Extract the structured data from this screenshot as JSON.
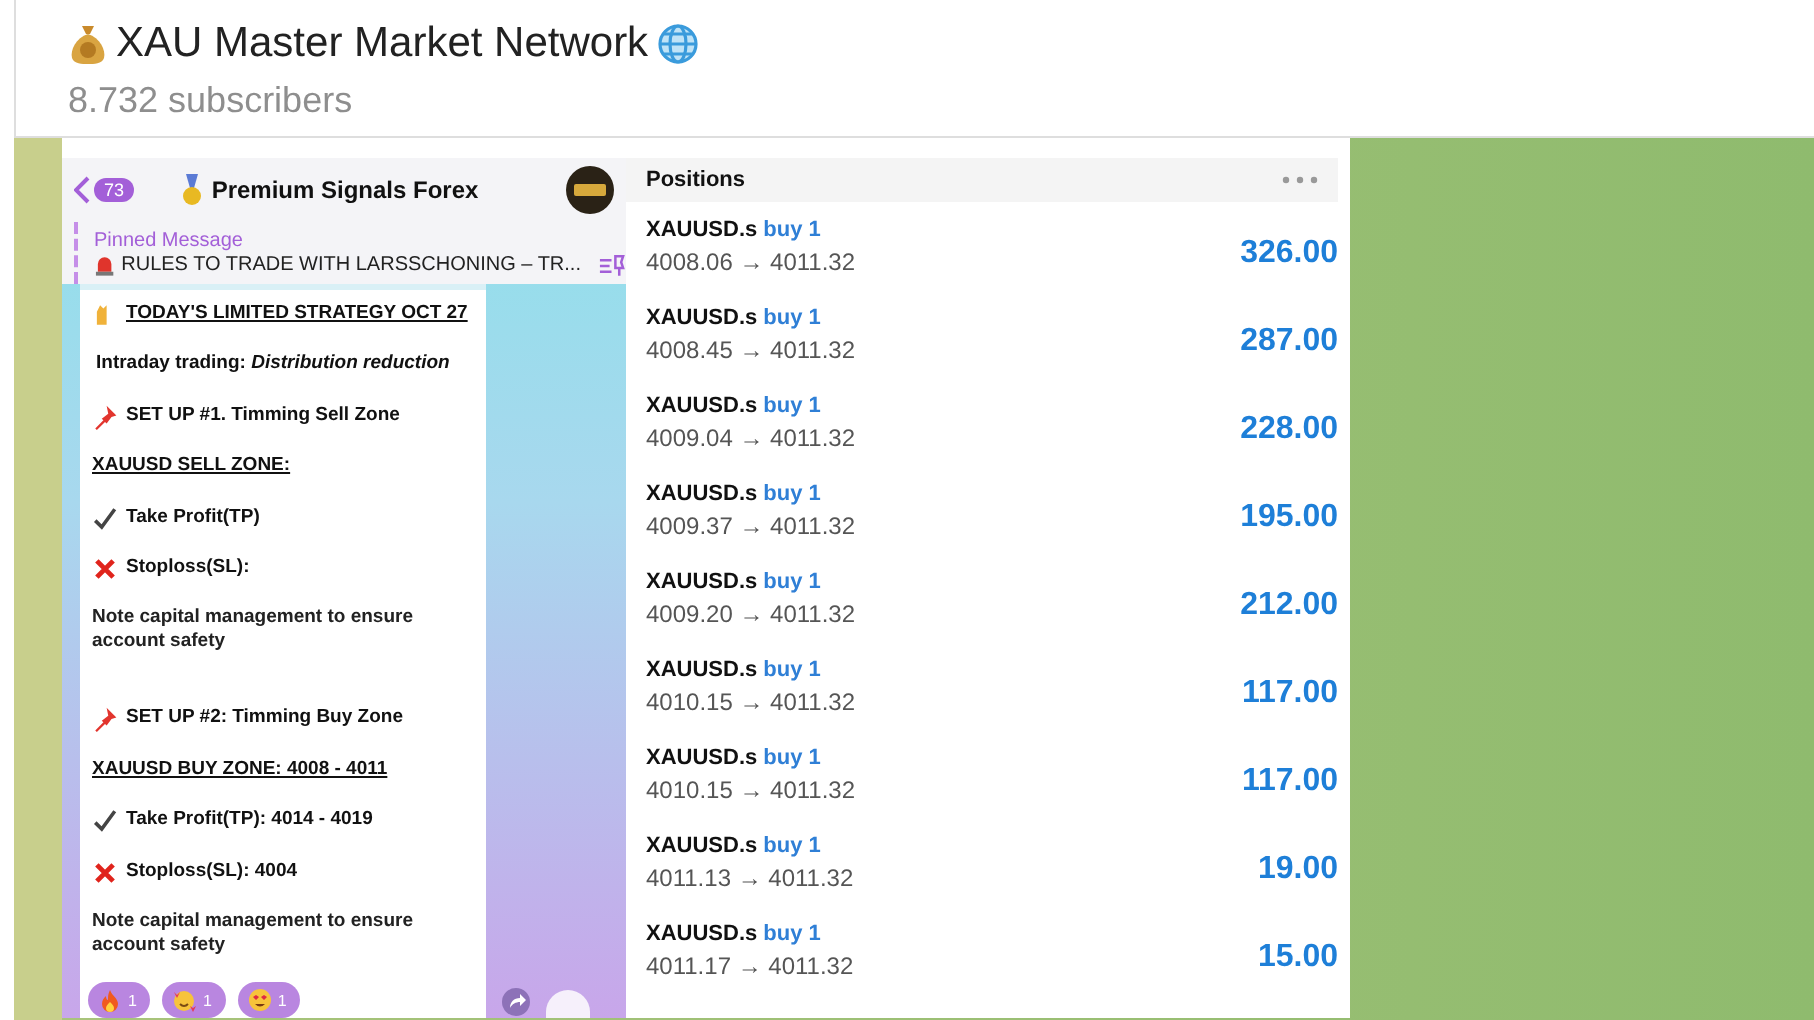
{
  "channel": {
    "title": "XAU Master Market Network",
    "subscribers": "8.732 subscribers"
  },
  "post": {
    "phone": {
      "back_count": "73",
      "title": "Premium Signals Forex",
      "pinned": {
        "label": "Pinned Message",
        "text": "RULES TO TRADE WITH LARSSCHONING – TR..."
      },
      "lines": [
        {
          "kind": "heading",
          "text": "TODAY'S LIMITED STRATEGY OCT 27"
        },
        {
          "kind": "plain",
          "text": "Intraday trading:  *Distribution reduction*"
        },
        {
          "kind": "setup",
          "text": "SET UP #1. Timming Sell Zone"
        },
        {
          "kind": "zone",
          "text": "XAUUSD SELL ZONE:"
        },
        {
          "kind": "target",
          "text": "Take Profit(TP)"
        },
        {
          "kind": "stop",
          "text": "Stoploss(SL):"
        },
        {
          "kind": "note",
          "text": "Note capital management to ensure account safety"
        },
        {
          "kind": "setup",
          "text": "SET UP #2: Timming Buy Zone"
        },
        {
          "kind": "zone",
          "text": "XAUUSD BUY ZONE: 4008 - 4011"
        },
        {
          "kind": "target",
          "text": "Take Profit(TP): 4014 - 4019"
        },
        {
          "kind": "stop",
          "text": "Stoploss(SL): 4004"
        },
        {
          "kind": "note",
          "text": "Note capital management to ensure account safety"
        }
      ],
      "reactions": [
        {
          "kind": "fire",
          "count": "1"
        },
        {
          "kind": "hearts",
          "count": "1"
        },
        {
          "kind": "heart-eyes",
          "count": "1"
        }
      ]
    },
    "positions": {
      "title": "Positions",
      "rows": [
        {
          "symbol": "XAUUSD.s",
          "side": "buy 1",
          "prices": "4008.06 → 4011.32",
          "profit": "326.00"
        },
        {
          "symbol": "XAUUSD.s",
          "side": "buy 1",
          "prices": "4008.45 → 4011.32",
          "profit": "287.00"
        },
        {
          "symbol": "XAUUSD.s",
          "side": "buy 1",
          "prices": "4009.04 → 4011.32",
          "profit": "228.00"
        },
        {
          "symbol": "XAUUSD.s",
          "side": "buy 1",
          "prices": "4009.37 → 4011.32",
          "profit": "195.00"
        },
        {
          "symbol": "XAUUSD.s",
          "side": "buy 1",
          "prices": "4009.20 → 4011.32",
          "profit": "212.00"
        },
        {
          "symbol": "XAUUSD.s",
          "side": "buy 1",
          "prices": "4010.15 → 4011.32",
          "profit": "117.00"
        },
        {
          "symbol": "XAUUSD.s",
          "side": "buy 1",
          "prices": "4010.15 → 4011.32",
          "profit": "117.00"
        },
        {
          "symbol": "XAUUSD.s",
          "side": "buy 1",
          "prices": "4011.13 → 4011.32",
          "profit": "19.00"
        },
        {
          "symbol": "XAUUSD.s",
          "side": "buy 1",
          "prices": "4011.17 → 4011.32",
          "profit": "15.00"
        }
      ]
    }
  }
}
